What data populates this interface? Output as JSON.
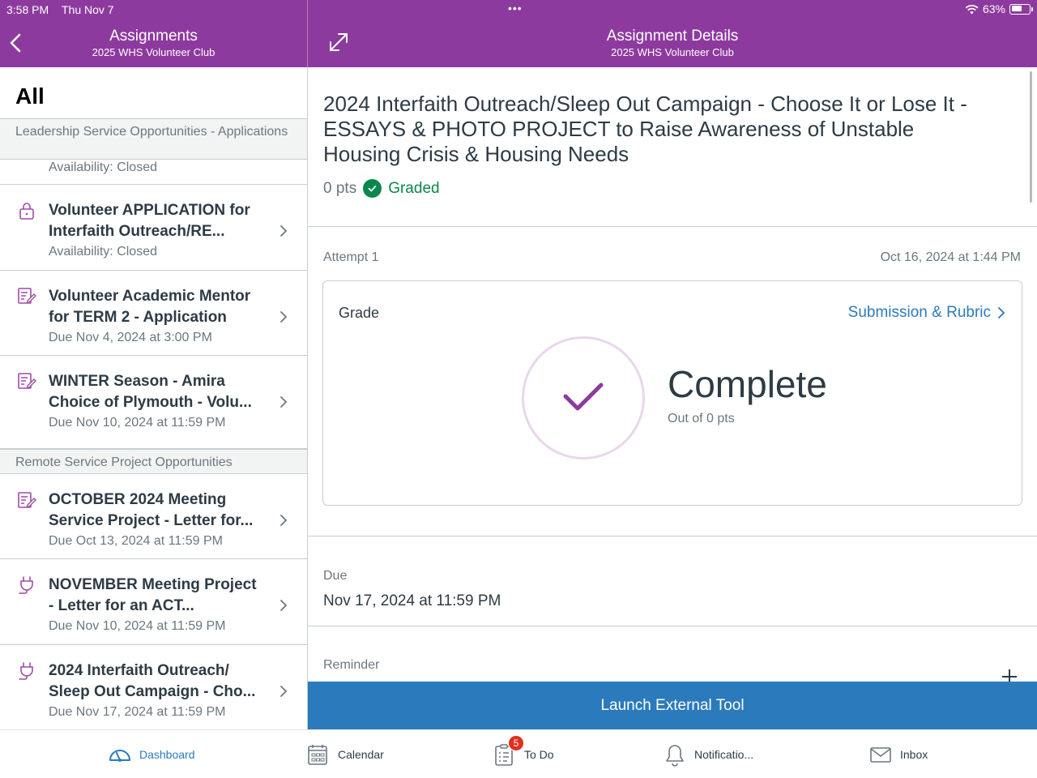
{
  "status_bar": {
    "time": "3:58 PM",
    "date": "Thu Nov 7",
    "dots": "•••",
    "battery": "63%",
    "battery_level": 0.63
  },
  "left_header": {
    "title": "Assignments",
    "subtitle": "2025 WHS Volunteer Club"
  },
  "right_header": {
    "title": "Assignment Details",
    "subtitle": "2025 WHS Volunteer Club"
  },
  "list": {
    "heading": "All",
    "sections": [
      {
        "label": "Leadership Service Opportunities - Applications"
      },
      {
        "label": "Remote Service Project Opportunities"
      }
    ],
    "partial_item": {
      "subtitle": "Availability: Closed"
    },
    "items": [
      {
        "icon": "lock-icon",
        "title": "Volunteer APPLICATION for Interfaith Outreach/RE...",
        "subtitle": "Availability: Closed"
      },
      {
        "icon": "assignment-icon",
        "title": "Volunteer Academic Mentor for TERM 2 - Application",
        "subtitle": "Due Nov 4, 2024 at 3:00 PM"
      },
      {
        "icon": "assignment-icon",
        "title": "WINTER Season - Amira Choice of Plymouth - Volu...",
        "subtitle": "Due Nov 10, 2024 at 11:59 PM"
      },
      {
        "icon": "assignment-icon",
        "title": "OCTOBER 2024 Meeting Service Project - Letter for...",
        "subtitle": "Due Oct 13, 2024 at 11:59 PM"
      },
      {
        "icon": "plug-icon",
        "title": "NOVEMBER Meeting Project - Letter for an ACT...",
        "subtitle": "Due Nov 10, 2024 at 11:59 PM"
      },
      {
        "icon": "plug-icon",
        "title": "2024 Interfaith Outreach/ Sleep Out Campaign - Cho...",
        "subtitle": "Due Nov 17, 2024 at 11:59 PM"
      }
    ]
  },
  "details": {
    "title": "2024 Interfaith Outreach/Sleep Out Campaign - Choose It or Lose It - ESSAYS & PHOTO PROJECT to Raise Awareness of Unstable Housing Crisis & Housing Needs",
    "points": "0 pts",
    "status": "Graded",
    "attempt": "Attempt 1",
    "attempt_date": "Oct 16, 2024 at 1:44 PM",
    "grade_label": "Grade",
    "submission_link": "Submission & Rubric",
    "grade_value": "Complete",
    "grade_out_of": "Out of 0 pts",
    "due_label": "Due",
    "due_value": "Nov 17, 2024 at 11:59 PM",
    "reminder_label": "Reminder",
    "launch_button": "Launch External Tool"
  },
  "tabbar": [
    {
      "label": "Dashboard",
      "icon": "dashboard-icon",
      "active": true
    },
    {
      "label": "Calendar",
      "icon": "calendar-icon",
      "active": false
    },
    {
      "label": "To Do",
      "icon": "todo-icon",
      "active": false,
      "badge": "5"
    },
    {
      "label": "Notificatio...",
      "icon": "bell-icon",
      "active": false
    },
    {
      "label": "Inbox",
      "icon": "inbox-icon",
      "active": false
    }
  ],
  "colors": {
    "header": "#8d3a9e",
    "accent": "#2b7abc",
    "graded": "#0b874b",
    "icon_purple": "#9e4ca5",
    "badge": "#e0301e"
  }
}
